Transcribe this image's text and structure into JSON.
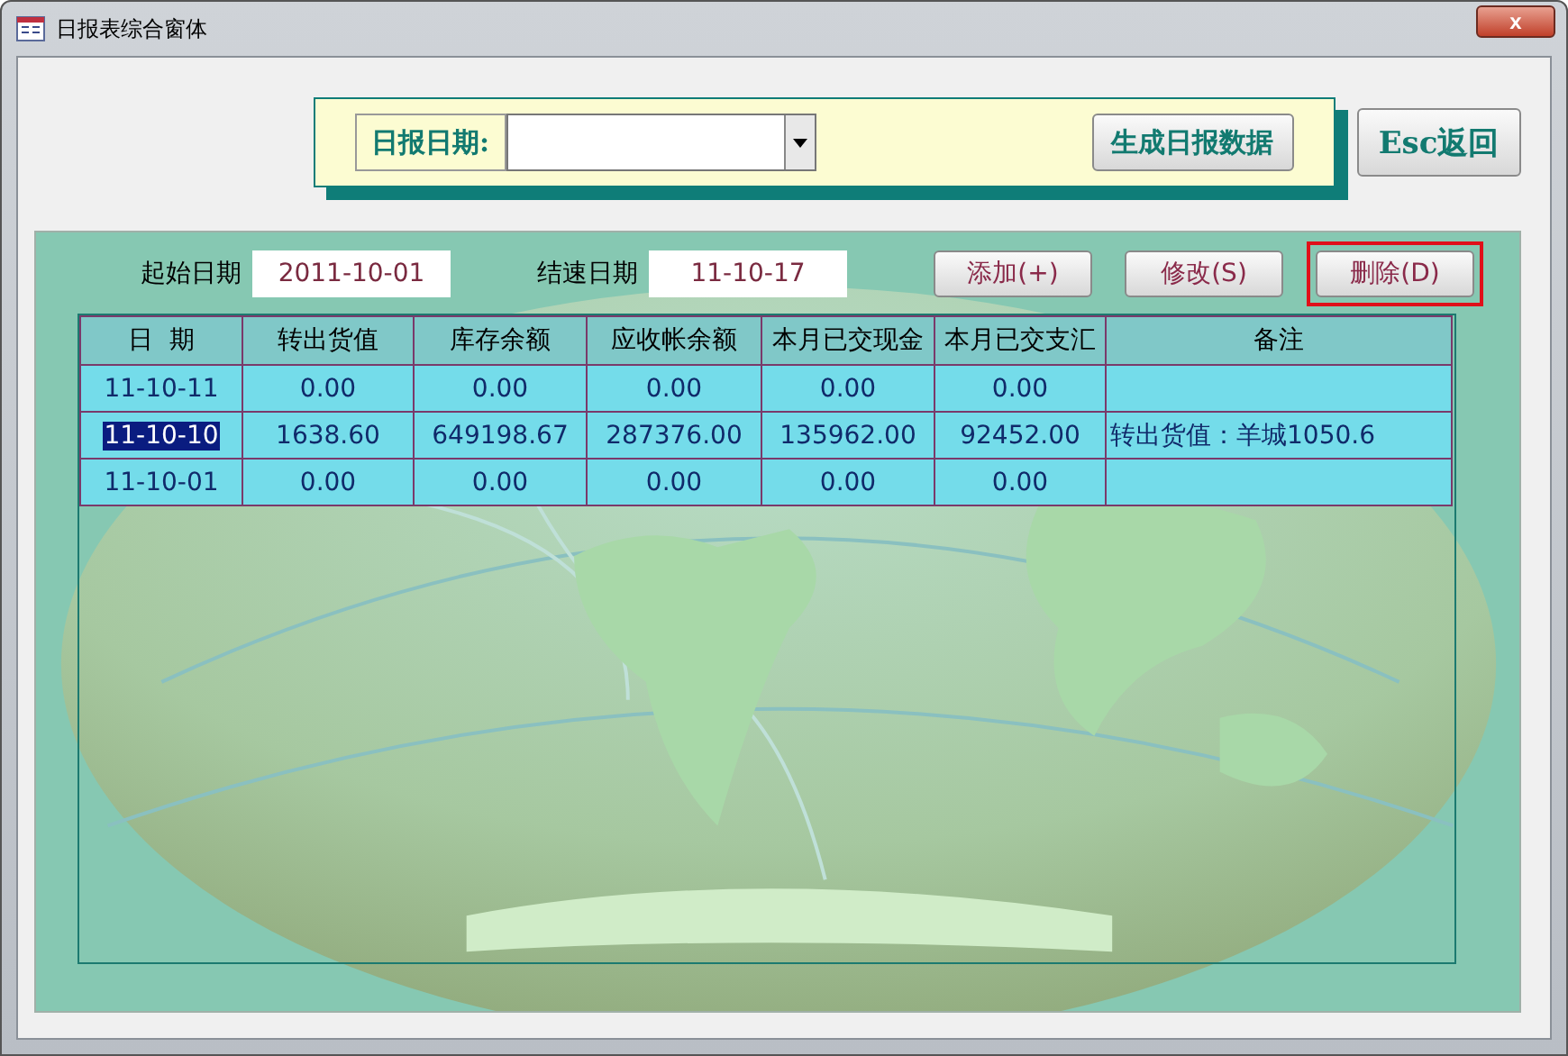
{
  "window": {
    "title": "日报表综合窗体",
    "close": "x"
  },
  "report_bar": {
    "label": "日报日期:",
    "generate_button": "生成日报数据"
  },
  "back_button": "Esc返回",
  "filter": {
    "start_label": "起始日期",
    "start_value": "2011-10-01",
    "end_label": "结速日期",
    "end_value": "11-10-17"
  },
  "buttons": [
    {
      "label": "添加(+)",
      "highlighted": false
    },
    {
      "label": "修改(S)",
      "highlighted": false
    },
    {
      "label": "删除(D)",
      "highlighted": true
    }
  ],
  "table": {
    "columns": [
      "日  期",
      "转出货值",
      "库存余额",
      "应收帐余额",
      "本月已交现金",
      "本月已交支汇",
      "备注"
    ],
    "rows": [
      {
        "selected": false,
        "cells": [
          "11-10-11",
          "0.00",
          "0.00",
          "0.00",
          "0.00",
          "0.00",
          ""
        ]
      },
      {
        "selected": true,
        "cells": [
          "11-10-10",
          "1638.60",
          "649198.67",
          "287376.00",
          "135962.00",
          "92452.00",
          "转出货值：羊城1050.6"
        ]
      },
      {
        "selected": false,
        "cells": [
          "11-10-01",
          "0.00",
          "0.00",
          "0.00",
          "0.00",
          "0.00",
          ""
        ]
      }
    ]
  }
}
